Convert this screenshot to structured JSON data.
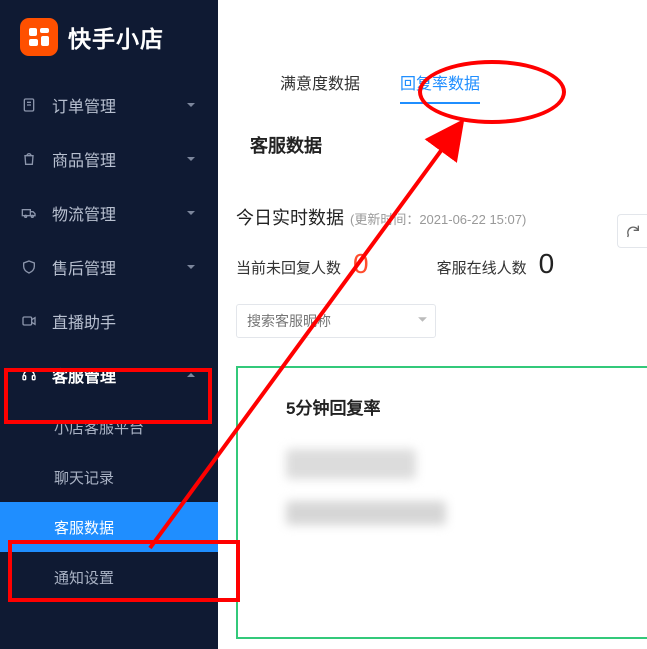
{
  "brand": {
    "name": "快手小店"
  },
  "sidebar": {
    "items": [
      {
        "label": "订单管理",
        "icon": "order"
      },
      {
        "label": "商品管理",
        "icon": "goods"
      },
      {
        "label": "物流管理",
        "icon": "logistics"
      },
      {
        "label": "售后管理",
        "icon": "aftersale"
      },
      {
        "label": "直播助手",
        "icon": "live"
      },
      {
        "label": "客服管理",
        "icon": "service"
      }
    ],
    "sub": {
      "items": [
        {
          "label": "小店客服平台"
        },
        {
          "label": "聊天记录"
        },
        {
          "label": "客服数据"
        },
        {
          "label": "通知设置"
        }
      ],
      "active_index": 2
    }
  },
  "tabs": {
    "items": [
      {
        "label": "满意度数据"
      },
      {
        "label": "回复率数据"
      }
    ],
    "active_index": 1
  },
  "section_title": "客服数据",
  "realtime": {
    "title": "今日实时数据",
    "subtitle": "(更新时间：2021-06-22 15:07)"
  },
  "stats": {
    "unreplied_label": "当前未回复人数",
    "unreplied_value": "0",
    "online_label": "客服在线人数",
    "online_value": "0"
  },
  "search": {
    "placeholder": "搜索客服昵称"
  },
  "panel": {
    "title": "5分钟回复率"
  },
  "colors": {
    "accent_blue": "#1f8eff",
    "accent_green": "#33c97a",
    "stat_red": "#ff4d2e",
    "brand_orange": "#ff5000"
  }
}
